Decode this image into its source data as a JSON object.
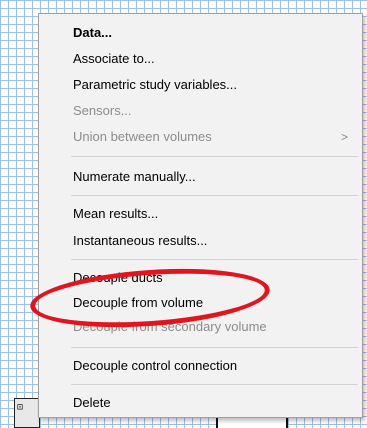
{
  "context_menu": {
    "items": [
      {
        "label": "Data...",
        "bold": true,
        "disabled": false
      },
      {
        "label": "Associate to...",
        "bold": false,
        "disabled": false
      },
      {
        "label": "Parametric study variables...",
        "bold": false,
        "disabled": false
      },
      {
        "label": "Sensors...",
        "bold": false,
        "disabled": true
      },
      {
        "label": "Union between volumes",
        "bold": false,
        "disabled": true,
        "submenu_arrow": ">"
      },
      {
        "label": "Numerate manually...",
        "bold": false,
        "disabled": false
      },
      {
        "label": "Mean results...",
        "bold": false,
        "disabled": false
      },
      {
        "label": "Instantaneous results...",
        "bold": false,
        "disabled": false
      },
      {
        "label": "Decouple ducts",
        "bold": false,
        "disabled": false
      },
      {
        "label": "Decouple from volume",
        "bold": false,
        "disabled": false
      },
      {
        "label": "Decouple from secondary volume",
        "bold": false,
        "disabled": true
      },
      {
        "label": "Decouple control connection",
        "bold": false,
        "disabled": false
      },
      {
        "label": "Delete",
        "bold": false,
        "disabled": false
      }
    ]
  },
  "annotation": {
    "color": "#e1151e",
    "highlights": "Decouple from volume"
  }
}
